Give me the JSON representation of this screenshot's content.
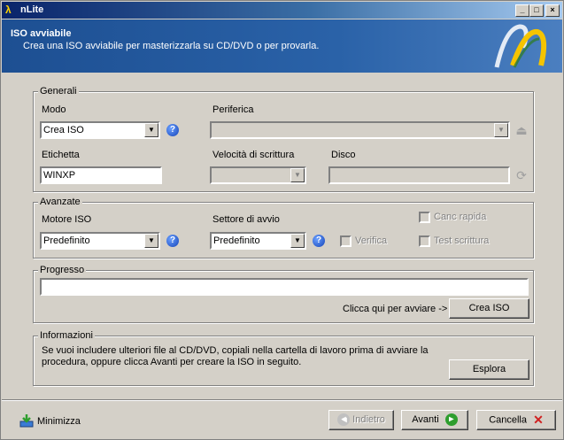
{
  "window": {
    "title": "nLite",
    "controls": [
      "_",
      "□",
      "×"
    ]
  },
  "header": {
    "title": "ISO avviabile",
    "subtitle": "Crea una ISO avviabile per masterizzarla su CD/DVD o per provarla."
  },
  "generali": {
    "legend": "Generali",
    "modo_label": "Modo",
    "modo_value": "Crea ISO",
    "periferica_label": "Periferica",
    "periferica_value": "",
    "etichetta_label": "Etichetta",
    "etichetta_value": "WINXP",
    "velocita_label": "Velocità di scrittura",
    "velocita_value": "",
    "disco_label": "Disco",
    "disco_value": ""
  },
  "avanzate": {
    "legend": "Avanzate",
    "motore_label": "Motore ISO",
    "motore_value": "Predefinito",
    "settore_label": "Settore di avvio",
    "settore_value": "Predefinito",
    "canc_rapida": "Canc rapida",
    "verifica": "Verifica",
    "test_scrittura": "Test scrittura"
  },
  "progresso": {
    "legend": "Progresso",
    "progress": 0,
    "hint": "Clicca qui per avviare ->",
    "button": "Crea ISO"
  },
  "informazioni": {
    "legend": "Informazioni",
    "text": "Se vuoi includere ulteriori file al CD/DVD, copiali nella cartella di lavoro prima di avviare la procedura, oppure clicca Avanti per creare la ISO in seguito.",
    "button": "Esplora"
  },
  "footer": {
    "minimize": "Minimizza",
    "back": "Indietro",
    "next": "Avanti",
    "cancel": "Cancella"
  },
  "icons": [
    "app-icon",
    "help-icon",
    "eject-icon",
    "refresh-icon",
    "minimize-tray-icon",
    "back-arrow-icon",
    "next-arrow-icon",
    "cancel-x-icon"
  ],
  "colors": {
    "header_blue": "#1d4f92",
    "dialog_gray": "#d4d0c8",
    "help_blue": "#1443b8",
    "next_green": "#2e9e2e",
    "cancel_red": "#d02020"
  }
}
